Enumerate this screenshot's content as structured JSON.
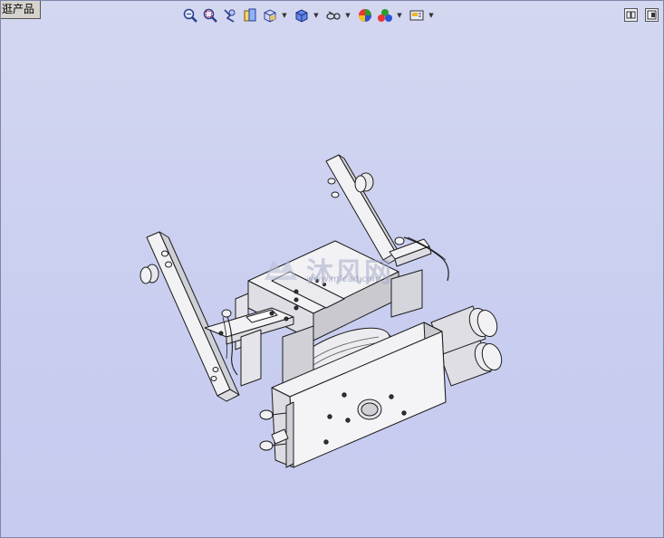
{
  "tab": {
    "label": "逛产品"
  },
  "toolbar": {
    "buttons": [
      {
        "name": "zoom-to-fit-icon",
        "dropdown": false
      },
      {
        "name": "zoom-to-area-icon",
        "dropdown": false
      },
      {
        "name": "previous-view-icon",
        "dropdown": false
      },
      {
        "name": "section-view-icon",
        "dropdown": false
      },
      {
        "name": "view-orientation-icon",
        "dropdown": true
      },
      {
        "name": "display-style-icon",
        "dropdown": true
      },
      {
        "name": "hide-show-items-icon",
        "dropdown": true
      },
      {
        "name": "edit-appearance-icon",
        "dropdown": false
      },
      {
        "name": "apply-scene-icon",
        "dropdown": true
      },
      {
        "name": "view-settings-icon",
        "dropdown": true
      }
    ]
  },
  "window_controls": [
    {
      "name": "restore-pane-icon"
    },
    {
      "name": "maximize-pane-icon"
    }
  ],
  "watermark": {
    "text": "沐风网",
    "url": "www.mfcad.com"
  },
  "colors": {
    "background": "#c9cef0",
    "part_fill": "#f2f2f4",
    "part_edge": "#1c1c1c",
    "shade": "#c9c9cf"
  }
}
